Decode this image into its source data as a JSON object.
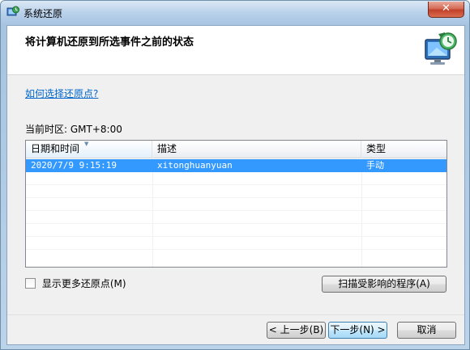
{
  "window": {
    "title": "系统还原",
    "close_glyph": "✕"
  },
  "header": {
    "title": "将计算机还原到所选事件之前的状态",
    "icon": "system-restore-icon"
  },
  "content": {
    "help_link": "如何选择还原点?",
    "timezone": "当前时区: GMT+8:00",
    "columns": [
      "日期和时间",
      "描述",
      "类型"
    ],
    "rows": [
      {
        "date": "2020/7/9 9:15:19",
        "description": "xitonghuanyuan",
        "type": "手动",
        "selected": true
      }
    ],
    "show_more_checkbox": {
      "label": "显示更多还原点(M)",
      "checked": false
    },
    "scan_button": "扫描受影响的程序(A)"
  },
  "footer": {
    "back_button": "< 上一步(B)",
    "next_button": "下一步(N) >",
    "cancel_button": "取消"
  },
  "colors": {
    "selection": "#3399ff",
    "link": "#0066cc",
    "close_button": "#c2402a"
  }
}
